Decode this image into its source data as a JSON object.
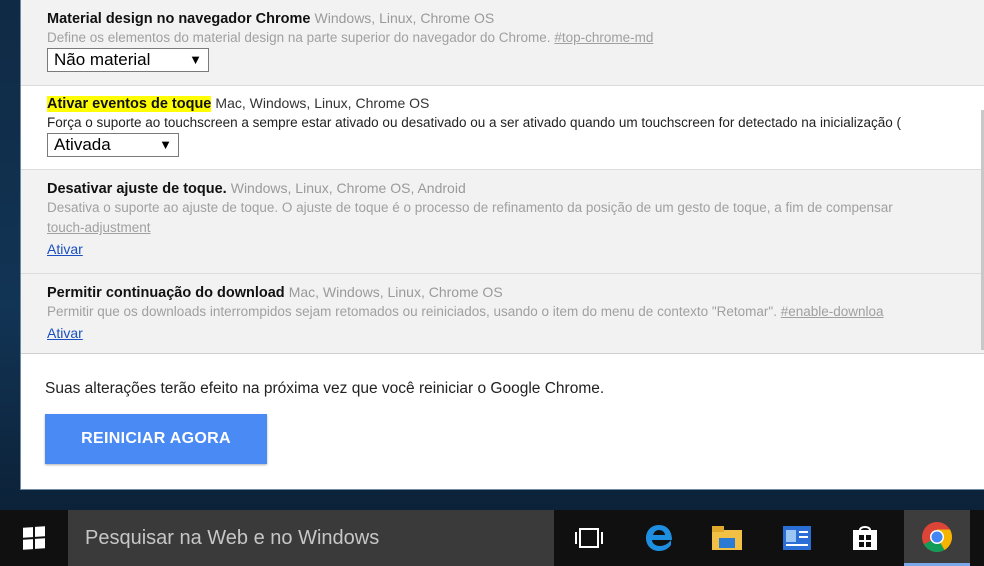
{
  "flags": [
    {
      "name": "Material design no navegador Chrome",
      "platforms": "Windows, Linux, Chrome OS",
      "description": "Define os elementos do material design na parte superior do navegador do Chrome.",
      "link": "#top-chrome-md",
      "select_value": "Não material"
    },
    {
      "name": "Ativar eventos de toque",
      "platforms": "Mac, Windows, Linux, Chrome OS",
      "description": "Força o suporte ao touchscreen a sempre estar ativado ou desativado ou a ser ativado quando um touchscreen for detectado na inicialização (",
      "select_value": "Ativada"
    },
    {
      "name": "Desativar ajuste de toque.",
      "platforms": "Windows, Linux, Chrome OS, Android",
      "description": "Desativa o suporte ao ajuste de toque. O ajuste de toque é o processo de refinamento da posição de um gesto de toque, a fim de compensar",
      "link": "touch-adjustment",
      "action": "Ativar"
    },
    {
      "name": "Permitir continuação do download",
      "platforms": "Mac, Windows, Linux, Chrome OS",
      "description": "Permitir que os downloads interrompidos sejam retomados ou reiniciados, usando o item do menu de contexto \"Retomar\".",
      "link": "#enable-downloa",
      "action": "Ativar"
    }
  ],
  "footer": {
    "message": "Suas alterações terão efeito na próxima vez que você reiniciar o Google Chrome.",
    "restart_label": "REINICIAR AGORA"
  },
  "taskbar": {
    "search_placeholder": "Pesquisar na Web e no Windows",
    "icons": [
      "windows-logo-icon",
      "task-view-icon",
      "edge-icon",
      "file-explorer-icon",
      "contacts-icon",
      "store-icon",
      "chrome-icon"
    ]
  },
  "colors": {
    "highlight": "#ffff00",
    "button_blue": "#4a8af4",
    "link_blue": "#1a4fc0",
    "taskbar": "#101010",
    "search_box": "#3a3a3a"
  }
}
